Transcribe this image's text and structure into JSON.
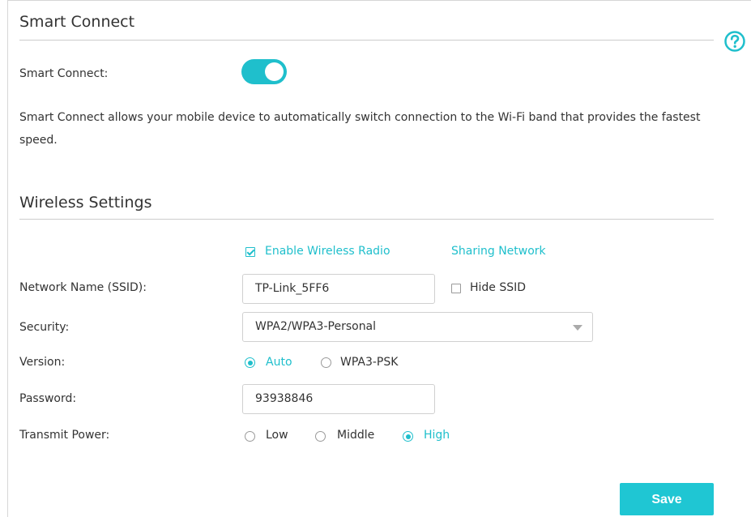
{
  "smart_connect": {
    "section_title": "Smart Connect",
    "label": "Smart Connect:",
    "enabled": true,
    "description": "Smart Connect allows your mobile device to automatically switch connection to the Wi-Fi band that provides the fastest speed."
  },
  "wireless": {
    "section_title": "Wireless Settings",
    "enable_radio_label": "Enable Wireless Radio",
    "enable_radio_checked": true,
    "sharing_network_link": "Sharing Network",
    "ssid_label": "Network Name (SSID):",
    "ssid_value": "TP-Link_5FF6",
    "hide_ssid_label": "Hide SSID",
    "hide_ssid_checked": false,
    "security_label": "Security:",
    "security_value": "WPA2/WPA3-Personal",
    "version_label": "Version:",
    "version_options": [
      "Auto",
      "WPA3-PSK"
    ],
    "version_selected": "Auto",
    "password_label": "Password:",
    "password_value": "93938846",
    "transmit_power_label": "Transmit Power:",
    "transmit_power_options": [
      "Low",
      "Middle",
      "High"
    ],
    "transmit_power_selected": "High"
  },
  "actions": {
    "save_label": "Save"
  },
  "icons": {
    "help": "help-icon"
  },
  "colors": {
    "accent": "#1fbfcc"
  }
}
